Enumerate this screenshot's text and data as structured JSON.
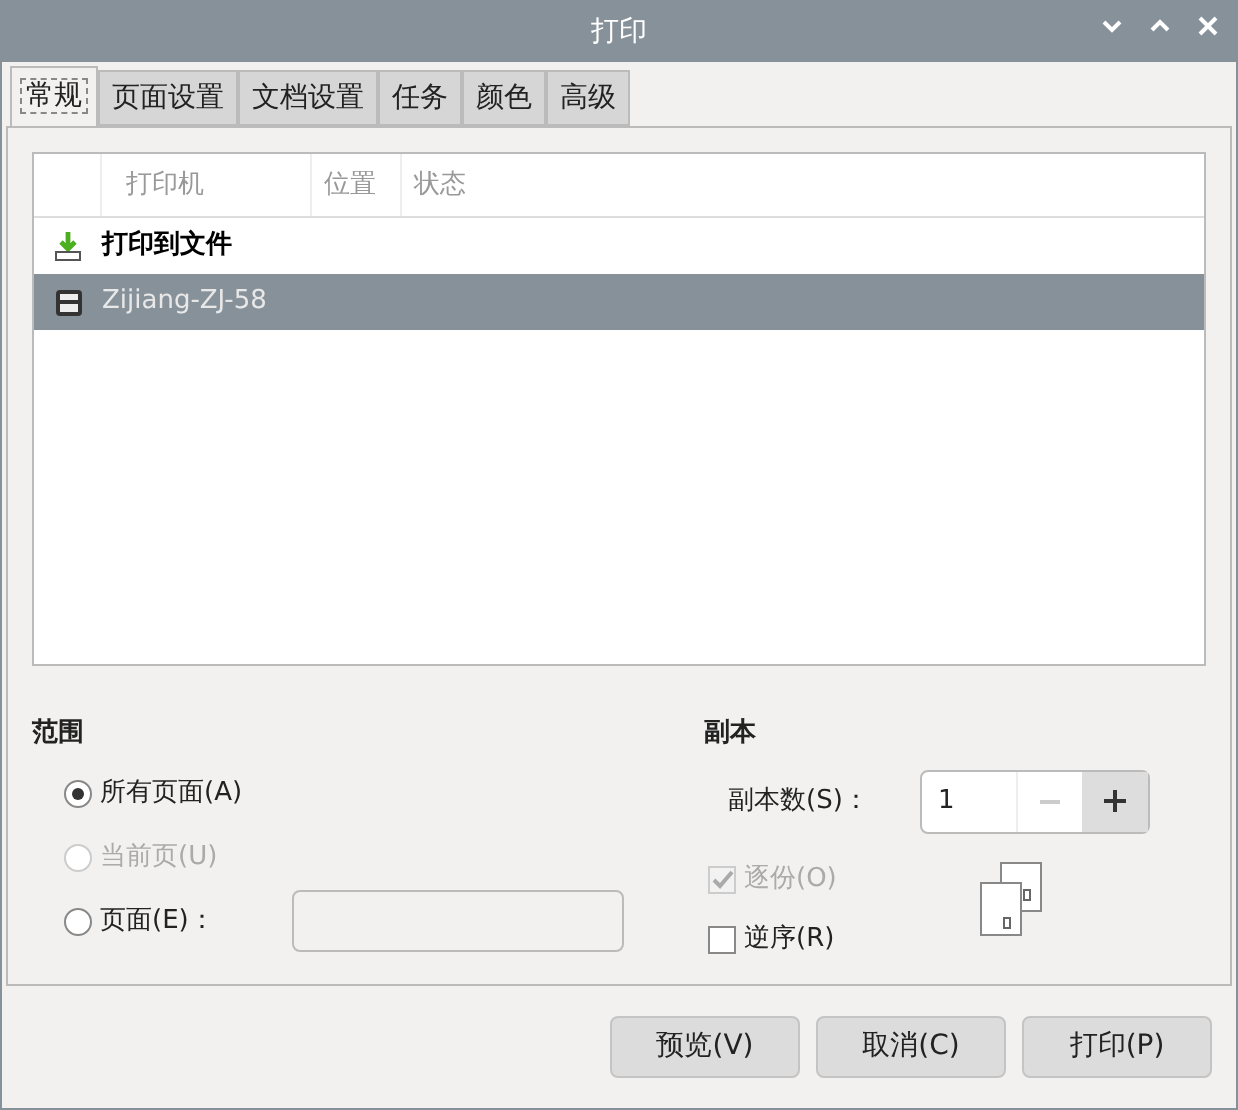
{
  "window": {
    "title": "打印"
  },
  "tabs": [
    {
      "label": "常规",
      "selected": true
    },
    {
      "label": "页面设置",
      "selected": false
    },
    {
      "label": "文档设置",
      "selected": false
    },
    {
      "label": "任务",
      "selected": false
    },
    {
      "label": "颜色",
      "selected": false
    },
    {
      "label": "高级",
      "selected": false
    }
  ],
  "printer_table": {
    "columns": [
      "打印机",
      "位置",
      "状态"
    ],
    "rows": [
      {
        "kind": "file",
        "name": "打印到文件",
        "selected": false
      },
      {
        "kind": "printer",
        "name": "Zijiang-ZJ-58",
        "selected": true
      }
    ]
  },
  "range": {
    "title": "范围",
    "options": [
      {
        "label": "所有页面(A)",
        "selected": true,
        "disabled": false
      },
      {
        "label": "当前页(U)",
        "selected": false,
        "disabled": true
      },
      {
        "label": "页面(E)：",
        "selected": false,
        "disabled": false,
        "field": true
      }
    ]
  },
  "copies": {
    "title": "副本",
    "count_label": "副本数(S)：",
    "count": "1",
    "minus_disabled": true,
    "options": [
      {
        "label": "逐份(O)",
        "checked": true,
        "disabled": true
      },
      {
        "label": "逆序(R)",
        "checked": false,
        "disabled": false
      }
    ]
  },
  "buttons": [
    "预览(V)",
    "取消(C)",
    "打印(P)"
  ]
}
